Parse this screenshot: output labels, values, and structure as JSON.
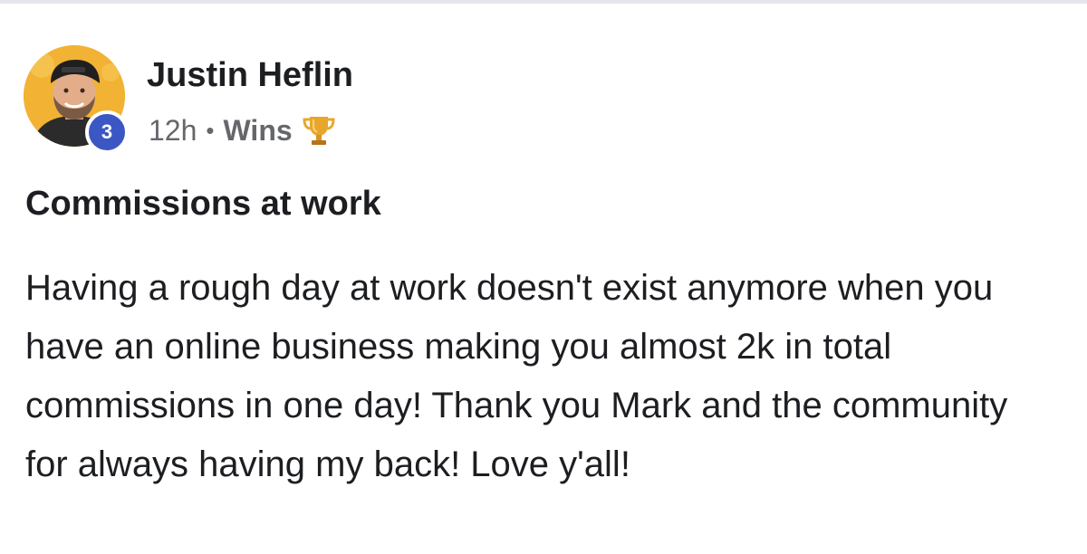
{
  "post": {
    "author": {
      "name": "Justin Heflin",
      "level": "3"
    },
    "meta": {
      "time": "12h",
      "separator": "•",
      "category": "Wins",
      "category_icon": "trophy-icon"
    },
    "title": "Commissions at work",
    "body": "Having a rough day at work doesn't exist anymore when you have an online business making you almost 2k in total commissions in one day! Thank you Mark and the community for always having my back! Love y'all!"
  },
  "colors": {
    "badge": "#3b57c4",
    "meta_text": "#65676b",
    "text": "#1c1e21",
    "avatar_bg": "#f2b233",
    "trophy": "#e8a72c"
  }
}
